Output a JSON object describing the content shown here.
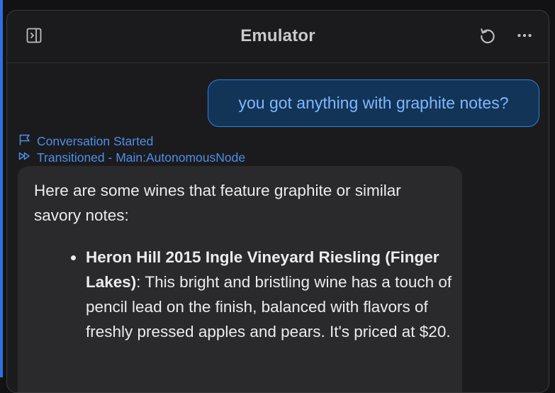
{
  "header": {
    "title": "Emulator",
    "icons": {
      "sidebar_toggle": "sidebar-toggle-icon",
      "reset": "refresh-icon",
      "more": "more-horizontal-icon"
    }
  },
  "user_message": {
    "text": "you got anything with graphite notes?"
  },
  "events": [
    {
      "icon": "flag-icon",
      "text": "Conversation Started"
    },
    {
      "icon": "fast-forward-icon",
      "text": "Transitioned - Main:AutonomousNode"
    }
  ],
  "assistant_message": {
    "intro": "Here are some wines that feature graphite or similar savory notes:",
    "items": [
      {
        "name": "Heron Hill 2015 Ingle Vineyard Riesling (Finger Lakes)",
        "description": ": This bright and bristling wine has a touch of pencil lead on the finish, balanced with flavors of freshly pressed apples and pears. It's priced at $20."
      }
    ]
  },
  "colors": {
    "accent": "#2f7fe2",
    "event_text": "#4d8fe8",
    "user_bubble_bg": "#123457",
    "user_text": "#7fb8ff",
    "panel_bg": "#1b1b1d",
    "assistant_bubble_bg": "#2a2a2c"
  }
}
